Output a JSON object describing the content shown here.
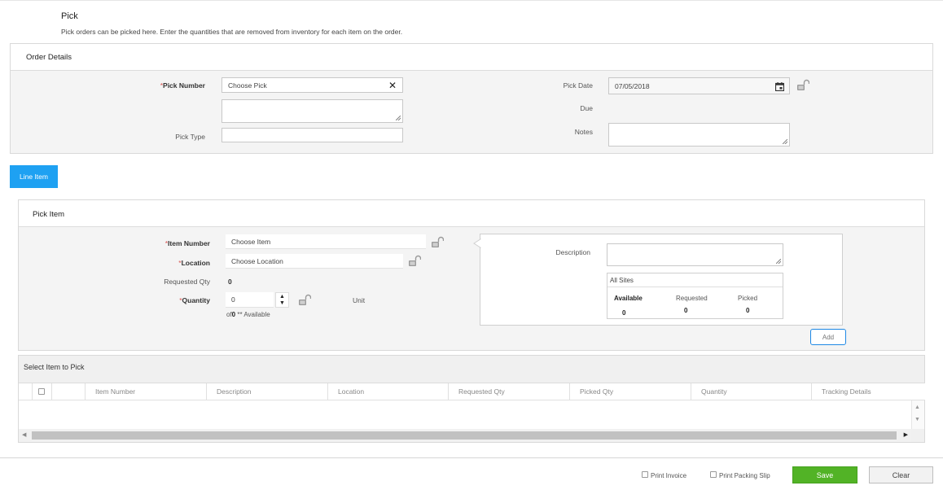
{
  "page": {
    "title": "Pick",
    "subtitle": "Pick orders can be picked here. Enter the quantities that are removed from inventory for each item on the order."
  },
  "order_details": {
    "heading": "Order Details",
    "pick_number_label": "Pick Number",
    "pick_number_placeholder": "Choose Pick",
    "pick_type_label": "Pick Type",
    "pick_type_value": "",
    "pick_date_label": "Pick Date",
    "pick_date_value": "07/05/2018",
    "due_label": "Due",
    "notes_label": "Notes"
  },
  "tabs": {
    "line_item": "Line Item"
  },
  "pick_item": {
    "heading": "Pick Item",
    "item_number_label": "Item Number",
    "item_number_placeholder": "Choose Item",
    "location_label": "Location",
    "location_placeholder": "Choose Location",
    "requested_qty_label": "Requested Qty",
    "requested_qty_value": "0",
    "quantity_label": "Quantity",
    "quantity_value": "0",
    "available_of": "of",
    "available_count": "0",
    "available_suffix": " ** Available",
    "unit_label": "Unit",
    "description_label": "Description",
    "sites": {
      "title": "All Sites",
      "available_label": "Available",
      "requested_label": "Requested",
      "picked_label": "Picked",
      "available_value": "0",
      "requested_value": "0",
      "picked_value": "0"
    },
    "add_button": "Add"
  },
  "select_grid": {
    "heading": "Select Item to Pick",
    "columns": [
      "Item Number",
      "Description",
      "Location",
      "Requested Qty",
      "Picked Qty",
      "Quantity",
      "Tracking Details"
    ]
  },
  "footer": {
    "print_invoice": "Print Invoice",
    "print_packing_slip": "Print Packing Slip",
    "save": "Save",
    "clear": "Clear"
  },
  "colors": {
    "accent": "#1ea1f2",
    "save": "#52b326",
    "required": "#d9534f"
  }
}
